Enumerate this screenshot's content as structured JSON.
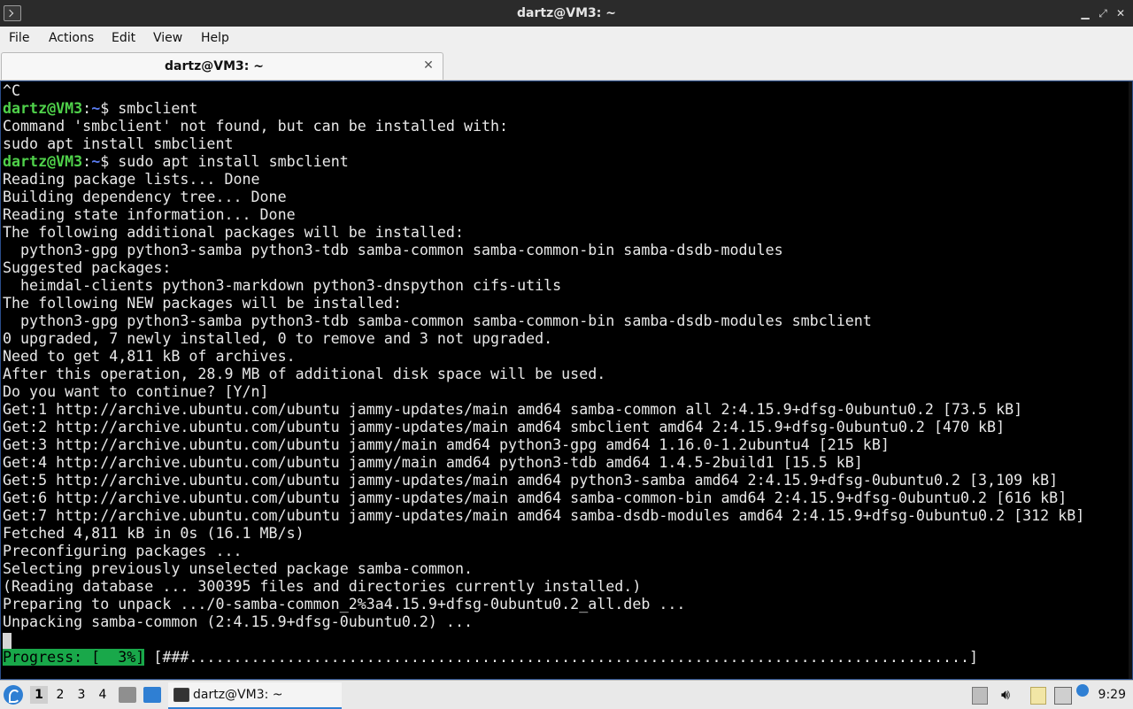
{
  "window": {
    "title": "dartz@VM3: ~"
  },
  "menu": {
    "items": [
      "File",
      "Actions",
      "Edit",
      "View",
      "Help"
    ]
  },
  "tab": {
    "label": "dartz@VM3: ~"
  },
  "prompt": {
    "user": "dartz@VM3",
    "sep": ":",
    "path": "~",
    "symbol": "$"
  },
  "terminal": {
    "lines": [
      {
        "text": "^C"
      },
      {
        "prompt": true,
        "cmd": " smbclient"
      },
      {
        "text": "Command 'smbclient' not found, but can be installed with:"
      },
      {
        "text": "sudo apt install smbclient"
      },
      {
        "prompt": true,
        "cmd": " sudo apt install smbclient"
      },
      {
        "text": "Reading package lists... Done"
      },
      {
        "text": "Building dependency tree... Done"
      },
      {
        "text": "Reading state information... Done"
      },
      {
        "text": "The following additional packages will be installed:"
      },
      {
        "text": "  python3-gpg python3-samba python3-tdb samba-common samba-common-bin samba-dsdb-modules"
      },
      {
        "text": "Suggested packages:"
      },
      {
        "text": "  heimdal-clients python3-markdown python3-dnspython cifs-utils"
      },
      {
        "text": "The following NEW packages will be installed:"
      },
      {
        "text": "  python3-gpg python3-samba python3-tdb samba-common samba-common-bin samba-dsdb-modules smbclient"
      },
      {
        "text": "0 upgraded, 7 newly installed, 0 to remove and 3 not upgraded."
      },
      {
        "text": "Need to get 4,811 kB of archives."
      },
      {
        "text": "After this operation, 28.9 MB of additional disk space will be used."
      },
      {
        "text": "Do you want to continue? [Y/n]"
      },
      {
        "text": "Get:1 http://archive.ubuntu.com/ubuntu jammy-updates/main amd64 samba-common all 2:4.15.9+dfsg-0ubuntu0.2 [73.5 kB]"
      },
      {
        "text": "Get:2 http://archive.ubuntu.com/ubuntu jammy-updates/main amd64 smbclient amd64 2:4.15.9+dfsg-0ubuntu0.2 [470 kB]"
      },
      {
        "text": "Get:3 http://archive.ubuntu.com/ubuntu jammy/main amd64 python3-gpg amd64 1.16.0-1.2ubuntu4 [215 kB]"
      },
      {
        "text": "Get:4 http://archive.ubuntu.com/ubuntu jammy/main amd64 python3-tdb amd64 1.4.5-2build1 [15.5 kB]"
      },
      {
        "text": "Get:5 http://archive.ubuntu.com/ubuntu jammy-updates/main amd64 python3-samba amd64 2:4.15.9+dfsg-0ubuntu0.2 [3,109 kB]"
      },
      {
        "text": "Get:6 http://archive.ubuntu.com/ubuntu jammy-updates/main amd64 samba-common-bin amd64 2:4.15.9+dfsg-0ubuntu0.2 [616 kB]"
      },
      {
        "text": "Get:7 http://archive.ubuntu.com/ubuntu jammy-updates/main amd64 samba-dsdb-modules amd64 2:4.15.9+dfsg-0ubuntu0.2 [312 kB]"
      },
      {
        "text": "Fetched 4,811 kB in 0s (16.1 MB/s)"
      },
      {
        "text": "Preconfiguring packages ..."
      },
      {
        "text": "Selecting previously unselected package samba-common."
      },
      {
        "text": "(Reading database ... 300395 files and directories currently installed.)"
      },
      {
        "text": "Preparing to unpack .../0-samba-common_2%3a4.15.9+dfsg-0ubuntu0.2_all.deb ..."
      },
      {
        "text": "Unpacking samba-common (2:4.15.9+dfsg-0ubuntu0.2) ..."
      },
      {
        "cursor": true
      },
      {
        "progress": true,
        "label": "Progress: [  3%]",
        "bar": " [###........................................................................................]"
      }
    ],
    "progress_fraction": 0.03
  },
  "taskbar": {
    "workspaces": [
      "1",
      "2",
      "3",
      "4"
    ],
    "active_workspace": "1",
    "window_label": "dartz@VM3: ~",
    "clock": "9:29",
    "icons": [
      "start-menu-icon",
      "file-manager-icon",
      "desktop-icon",
      "clipboard-icon",
      "volume-icon",
      "notes-icon",
      "network-icon",
      "update-notifier-icon"
    ]
  },
  "colors": {
    "prompt_user": "#4fd14a",
    "prompt_path": "#5a7cf0",
    "progress_bg": "#19a84a",
    "accent": "#2f7fd3"
  }
}
